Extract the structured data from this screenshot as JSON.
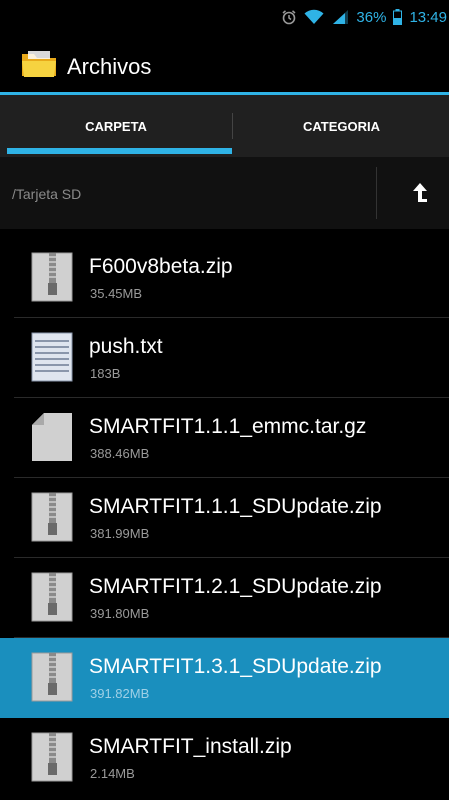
{
  "status_bar": {
    "battery": "36%",
    "time": "13:49"
  },
  "app": {
    "title": "Archivos"
  },
  "tabs": [
    {
      "label": "CARPETA"
    },
    {
      "label": "CATEGORIA"
    }
  ],
  "path": {
    "text": "/Tarjeta SD"
  },
  "files": [
    {
      "name": "F600v8beta.zip",
      "size": "35.45MB",
      "icon": "zip-file-icon"
    },
    {
      "name": "push.txt",
      "size": "183B",
      "icon": "text-file-icon"
    },
    {
      "name": "SMARTFIT1.1.1_emmc.tar.gz",
      "size": "388.46MB",
      "icon": "generic-file-icon"
    },
    {
      "name": "SMARTFIT1.1.1_SDUpdate.zip",
      "size": "381.99MB",
      "icon": "zip-file-icon"
    },
    {
      "name": "SMARTFIT1.2.1_SDUpdate.zip",
      "size": "391.80MB",
      "icon": "zip-file-icon"
    },
    {
      "name": "SMARTFIT1.3.1_SDUpdate.zip",
      "size": "391.82MB",
      "icon": "zip-file-icon",
      "selected": true
    },
    {
      "name": "SMARTFIT_install.zip",
      "size": "2.14MB",
      "icon": "zip-file-icon"
    }
  ],
  "colors": {
    "accent": "#2fb3e6",
    "selected_row": "#1a8fbe",
    "background": "#000000"
  }
}
